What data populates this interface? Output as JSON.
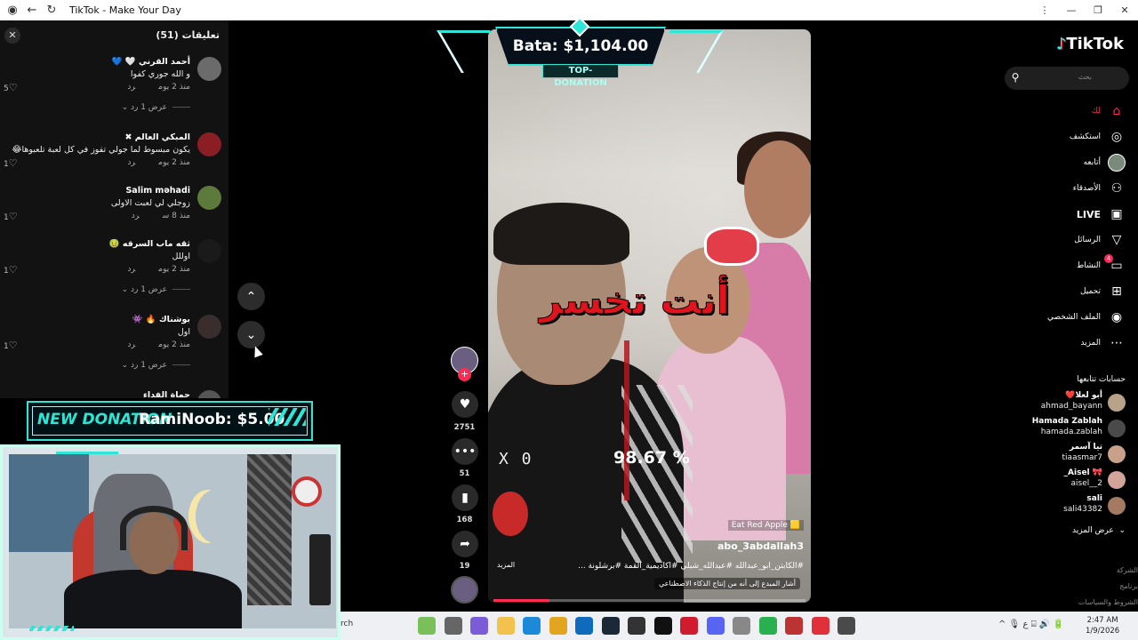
{
  "window": {
    "title": "TikTok - Make Your Day",
    "controls": [
      "⋮",
      "—",
      "❐",
      "✕"
    ]
  },
  "comments": {
    "header": "تعليقات (51)",
    "close_icon": "close-icon",
    "items": [
      {
        "user": "أحمد القرني 🤍 💙",
        "text": "و الله جوري كفوا",
        "date": "منذ 2 يوم",
        "reply": "رد",
        "likes": "5",
        "replies": "عرض 1 رد",
        "avatar_color": "#6b6b6b"
      },
      {
        "user": "المبكي العالم ✖",
        "text": "يكون مبسوط لما جولي تفوز في كل لعبة تلعبوها😂",
        "date": "منذ 2 يوم",
        "reply": "رد",
        "likes": "1",
        "avatar_color": "#8b1e24"
      },
      {
        "user": "Salim məhadi",
        "text": "زوجلي لي لعبت الاولى",
        "date": "منذ 8 س",
        "reply": "رد",
        "likes": "1",
        "avatar_color": "#5c7a3a"
      },
      {
        "user": "ثقه ماب السرقه 🤢",
        "text": "اوللل",
        "date": "منذ 2 يوم",
        "reply": "رد",
        "likes": "1",
        "replies": "عرض 1 رد",
        "avatar_color": "#1a1a1a"
      },
      {
        "user": "بوشناك 🔥 👾",
        "text": "اول",
        "date": "منذ 2 يوم",
        "reply": "رد",
        "likes": "1",
        "replies": "عرض 1 رد",
        "avatar_color": "#3a2d2d"
      },
      {
        "user": "حماة الفداء",
        "text": "",
        "date": "",
        "reply": "",
        "likes": "0",
        "avatar_color": "#555555"
      }
    ]
  },
  "video": {
    "overlay_text": "أنت تخسر",
    "multiplier": "X 0",
    "percent": "98.67 %",
    "music": "Eat Red Apple 🟨",
    "author": "abo_3abdallah3",
    "description": "#الكابتن_ابو_عبدالله #عبدالله_شبلي #اكاديمية_القمة #برشلونة ...",
    "more": "المزيد",
    "ai_label": "أشار المبدع إلى أنه من إنتاج الذكاء الاصطناعي",
    "progress": 0.18
  },
  "top_donation": {
    "amount": "Bata: $1,104.00",
    "label": "TOP-DONATION"
  },
  "actions": {
    "follow_plus": "+",
    "likes": "2751",
    "comments": "51",
    "saves": "168",
    "shares": "19"
  },
  "sidebar": {
    "logo": "TikTok",
    "search_placeholder": "بحث",
    "nav": [
      {
        "label": "لك",
        "icon": "home-icon",
        "glyph": "⌂",
        "active": true
      },
      {
        "label": "استكشف",
        "icon": "compass-icon",
        "glyph": "◎"
      },
      {
        "label": "أتابعه",
        "icon": "following-avatar-icon",
        "glyph": "●"
      },
      {
        "label": "الأصدقاء",
        "icon": "friends-icon",
        "glyph": "👥"
      },
      {
        "label": "LIVE",
        "icon": "live-icon",
        "glyph": "▣"
      },
      {
        "label": "الرسائل",
        "icon": "messages-icon",
        "glyph": "▽"
      },
      {
        "label": "النشاط",
        "icon": "activity-icon",
        "glyph": "▭",
        "badge": "4"
      },
      {
        "label": "تحميل",
        "icon": "upload-icon",
        "glyph": "⊞"
      },
      {
        "label": "الملف الشخصي",
        "icon": "profile-icon",
        "glyph": "◉"
      },
      {
        "label": "المزيد",
        "icon": "more-icon",
        "glyph": "⋯"
      }
    ],
    "following_title": "حسابات تتابعها",
    "following": [
      {
        "name": "أبو لعلا❤️",
        "handle": "ahmad_bayann",
        "avatar_color": "#b9a28a"
      },
      {
        "name": "Hamada Zablah",
        "handle": "hamada.zablah",
        "avatar_color": "#4a4a4a"
      },
      {
        "name": "تيا آسمر",
        "handle": "tiaasmar7",
        "avatar_color": "#c9a08a"
      },
      {
        "name": "🎀 Aisel_",
        "handle": "aisel__2",
        "avatar_color": "#d3a49a"
      },
      {
        "name": "sali",
        "handle": "sali43382",
        "avatar_color": "#a47a62"
      }
    ],
    "see_more": "عرض المزيد",
    "footer": [
      "الشركة",
      "برنامج",
      "الشروط والسياسات"
    ]
  },
  "new_donation": {
    "label": "NEW DONATION",
    "text": "RamiNoob: $5.00"
  },
  "taskbar": {
    "search": "rch",
    "icons": [
      {
        "name": "widgets-icon",
        "color": "#7bbf5b"
      },
      {
        "name": "task-view-icon",
        "color": "#666"
      },
      {
        "name": "copilot-icon",
        "color": "#7a5cd6"
      },
      {
        "name": "file-explorer-icon",
        "color": "#f2c14e"
      },
      {
        "name": "edge-icon",
        "color": "#1c8ad8"
      },
      {
        "name": "store-icon",
        "color": "#e2a520"
      },
      {
        "name": "outlook-icon",
        "color": "#0f6cbd"
      },
      {
        "name": "steam-icon",
        "color": "#1b2838"
      },
      {
        "name": "4k-icon",
        "color": "#333"
      },
      {
        "name": "tiktok-icon",
        "color": "#111"
      },
      {
        "name": "opera-icon",
        "color": "#d01c2e"
      },
      {
        "name": "discord-icon",
        "color": "#5865f2"
      },
      {
        "name": "app-icon",
        "color": "#888"
      },
      {
        "name": "whatsapp-icon",
        "color": "#2ab04f"
      },
      {
        "name": "media-icon",
        "color": "#b33"
      },
      {
        "name": "tf-icon",
        "color": "#e0303a"
      },
      {
        "name": "installer-icon",
        "color": "#4a4a4a"
      }
    ],
    "tray": "^  🎙  ع  ⌸  🔊  🔋",
    "time": "2:47 AM",
    "date": "1/9/2026"
  }
}
